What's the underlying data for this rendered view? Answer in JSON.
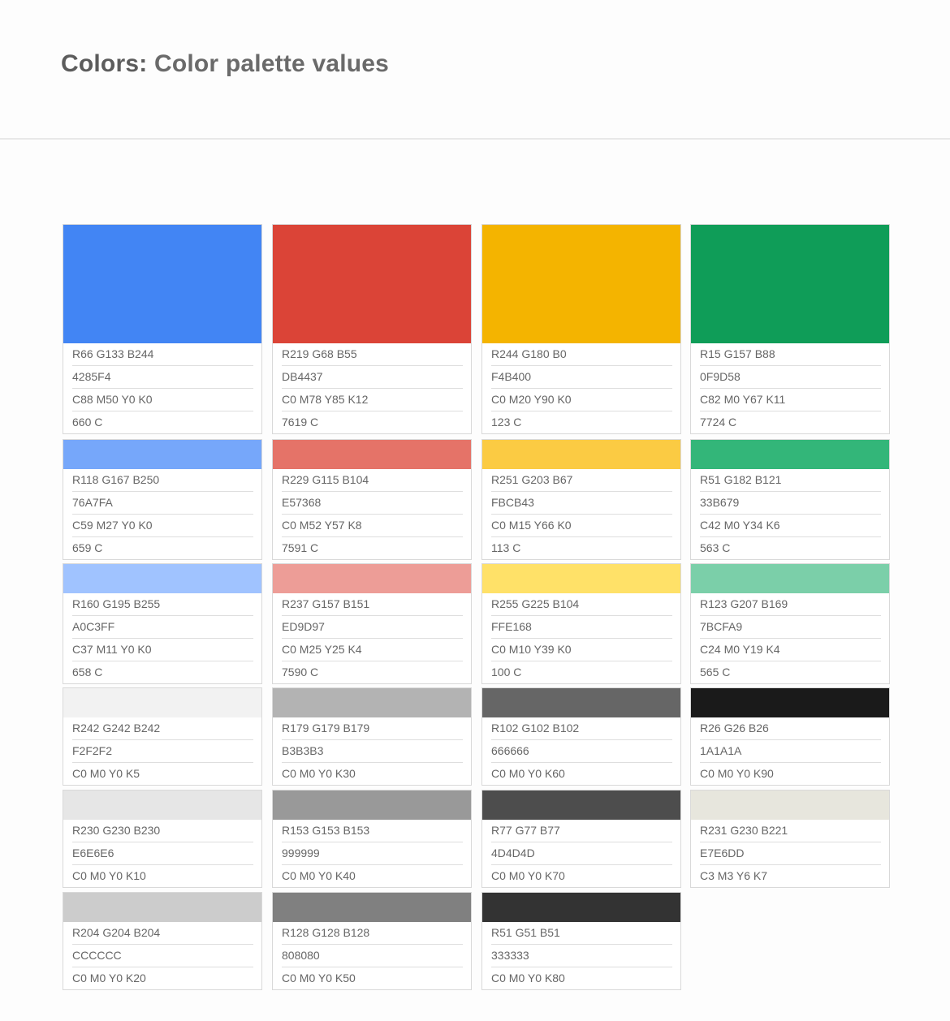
{
  "header": {
    "title_prefix": "Colors:",
    "title_rest": "Color palette values"
  },
  "palette": [
    [
      {
        "hex_color": "#4285F4",
        "lines": [
          "R66 G133 B244",
          "4285F4",
          "C88 M50 Y0 K0",
          "660 C"
        ]
      },
      {
        "hex_color": "#DB4437",
        "lines": [
          "R219 G68 B55",
          "DB4437",
          "C0 M78 Y85 K12",
          "7619 C"
        ]
      },
      {
        "hex_color": "#F4B400",
        "lines": [
          "R244 G180 B0",
          "F4B400",
          "C0 M20 Y90 K0",
          "123 C"
        ]
      },
      {
        "hex_color": "#0F9D58",
        "lines": [
          "R15 G157 B88",
          "0F9D58",
          "C82 M0 Y67 K11",
          "7724 C"
        ]
      }
    ],
    [
      {
        "hex_color": "#76A7FA",
        "lines": [
          "R118 G167 B250",
          "76A7FA",
          "C59 M27 Y0 K0",
          "659 C"
        ]
      },
      {
        "hex_color": "#E57368",
        "lines": [
          "R229 G115 B104",
          "E57368",
          "C0 M52 Y57 K8",
          "7591 C"
        ]
      },
      {
        "hex_color": "#FBCB43",
        "lines": [
          "R251 G203 B67",
          "FBCB43",
          "C0 M15 Y66 K0",
          "113 C"
        ]
      },
      {
        "hex_color": "#33B679",
        "lines": [
          "R51 G182  B121",
          "33B679",
          "C42 M0 Y34 K6",
          "563 C"
        ]
      }
    ],
    [
      {
        "hex_color": "#A0C3FF",
        "lines": [
          "R160 G195 B255",
          "A0C3FF",
          "C37 M11 Y0 K0",
          "658 C"
        ]
      },
      {
        "hex_color": "#ED9D97",
        "lines": [
          "R237 G157 B151",
          "ED9D97",
          "C0 M25 Y25 K4",
          "7590 C"
        ]
      },
      {
        "hex_color": "#FFE168",
        "lines": [
          "R255 G225 B104",
          "FFE168",
          "C0 M10 Y39 K0",
          "100 C"
        ]
      },
      {
        "hex_color": "#7BCFA9",
        "lines": [
          "R123 G207 B169",
          "7BCFA9",
          "C24 M0 Y19 K4",
          "565 C"
        ]
      }
    ],
    [
      {
        "hex_color": "#F2F2F2",
        "lines": [
          "R242 G242 B242",
          "F2F2F2",
          "C0 M0 Y0 K5"
        ]
      },
      {
        "hex_color": "#B3B3B3",
        "lines": [
          "R179 G179 B179",
          "B3B3B3",
          "C0 M0 Y0 K30"
        ]
      },
      {
        "hex_color": "#666666",
        "lines": [
          "R102 G102 B102",
          "666666",
          "C0 M0 Y0 K60"
        ]
      },
      {
        "hex_color": "#1A1A1A",
        "lines": [
          "R26 G26 B26",
          "1A1A1A",
          "C0 M0 Y0 K90"
        ]
      }
    ],
    [
      {
        "hex_color": "#E6E6E6",
        "lines": [
          "R230 G230 B230",
          "E6E6E6",
          "C0 M0 Y0 K10"
        ]
      },
      {
        "hex_color": "#999999",
        "lines": [
          "R153 G153 B153",
          "999999",
          "C0 M0 Y0 K40"
        ]
      },
      {
        "hex_color": "#4D4D4D",
        "lines": [
          "R77 G77 B77",
          "4D4D4D",
          "C0 M0 Y0 K70"
        ]
      },
      {
        "hex_color": "#E7E6DD",
        "lines": [
          "R231 G230 B221",
          "E7E6DD",
          "C3 M3 Y6 K7"
        ]
      }
    ],
    [
      {
        "hex_color": "#CCCCCC",
        "lines": [
          "R204 G204 B204",
          "CCCCCC",
          "C0 M0 Y0 K20"
        ]
      },
      {
        "hex_color": "#808080",
        "lines": [
          "R128 G128 B128",
          "808080",
          "C0 M0 Y0 K50"
        ]
      },
      {
        "hex_color": "#333333",
        "lines": [
          "R51 G51 B51",
          "333333",
          "C0 M0 Y0 K80"
        ]
      }
    ]
  ]
}
